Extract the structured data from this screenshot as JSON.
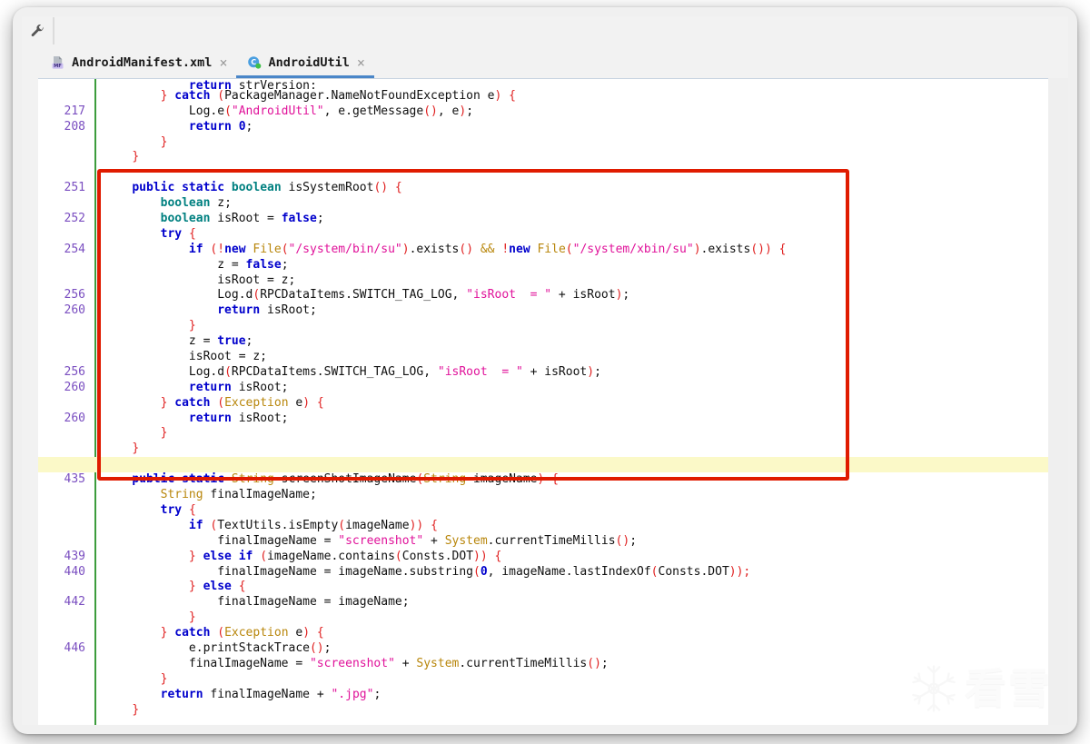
{
  "window": {
    "toolbar": {
      "wrench_icon": "wrench-icon"
    }
  },
  "tabs": [
    {
      "label": "AndroidManifest.xml",
      "icon": "manifest-file-icon",
      "close": "×",
      "active": false
    },
    {
      "label": "AndroidUtil",
      "icon": "java-class-icon",
      "close": "×",
      "active": true
    }
  ],
  "editor": {
    "language": "java",
    "annotation": {
      "type": "red-rectangle",
      "color": "#e01b00",
      "highlight_line_color": "#fbf9c8"
    },
    "lines": [
      {
        "num": "",
        "indent": 0,
        "clipped": true,
        "tokens": [
          {
            "t": "            ",
            "c": "pln"
          },
          {
            "t": "return",
            "c": "kw"
          },
          {
            "t": " strVersion;",
            "c": "pln"
          }
        ]
      },
      {
        "num": "",
        "tokens": [
          {
            "t": "        ",
            "c": "pln"
          },
          {
            "t": "}",
            "c": "brc"
          },
          {
            "t": " ",
            "c": "pln"
          },
          {
            "t": "catch",
            "c": "kw"
          },
          {
            "t": " ",
            "c": "pln"
          },
          {
            "t": "(",
            "c": "pun"
          },
          {
            "t": "PackageManager.NameNotFoundException e",
            "c": "pln"
          },
          {
            "t": ")",
            "c": "pun"
          },
          {
            "t": " ",
            "c": "pln"
          },
          {
            "t": "{",
            "c": "brc"
          }
        ]
      },
      {
        "num": "217",
        "tokens": [
          {
            "t": "            Log.e",
            "c": "pln"
          },
          {
            "t": "(",
            "c": "pun"
          },
          {
            "t": "\"AndroidUtil\"",
            "c": "str"
          },
          {
            "t": ", e.getMessage",
            "c": "pln"
          },
          {
            "t": "()",
            "c": "pun"
          },
          {
            "t": ", e",
            "c": "pln"
          },
          {
            "t": ")",
            "c": "pun"
          },
          {
            "t": ";",
            "c": "pln"
          }
        ]
      },
      {
        "num": "208",
        "tokens": [
          {
            "t": "            ",
            "c": "pln"
          },
          {
            "t": "return",
            "c": "kw"
          },
          {
            "t": " ",
            "c": "pln"
          },
          {
            "t": "0",
            "c": "kw"
          },
          {
            "t": ";",
            "c": "pln"
          }
        ]
      },
      {
        "num": "",
        "tokens": [
          {
            "t": "        ",
            "c": "pln"
          },
          {
            "t": "}",
            "c": "brc"
          }
        ]
      },
      {
        "num": "",
        "tokens": [
          {
            "t": "    ",
            "c": "pln"
          },
          {
            "t": "}",
            "c": "brc"
          }
        ]
      },
      {
        "num": "",
        "tokens": [
          {
            "t": "",
            "c": "pln"
          }
        ]
      },
      {
        "num": "251",
        "tokens": [
          {
            "t": "    ",
            "c": "pln"
          },
          {
            "t": "public static ",
            "c": "kw"
          },
          {
            "t": "boolean",
            "c": "kw2"
          },
          {
            "t": " isSystemRoot",
            "c": "pln"
          },
          {
            "t": "()",
            "c": "pun"
          },
          {
            "t": " ",
            "c": "pln"
          },
          {
            "t": "{",
            "c": "brc"
          }
        ]
      },
      {
        "num": "",
        "tokens": [
          {
            "t": "        ",
            "c": "pln"
          },
          {
            "t": "boolean",
            "c": "kw2"
          },
          {
            "t": " z;",
            "c": "pln"
          }
        ]
      },
      {
        "num": "252",
        "tokens": [
          {
            "t": "        ",
            "c": "pln"
          },
          {
            "t": "boolean",
            "c": "kw2"
          },
          {
            "t": " isRoot = ",
            "c": "pln"
          },
          {
            "t": "false",
            "c": "kw"
          },
          {
            "t": ";",
            "c": "pln"
          }
        ]
      },
      {
        "num": "",
        "tokens": [
          {
            "t": "        ",
            "c": "pln"
          },
          {
            "t": "try",
            "c": "kw"
          },
          {
            "t": " ",
            "c": "pln"
          },
          {
            "t": "{",
            "c": "brc"
          }
        ]
      },
      {
        "num": "254",
        "tokens": [
          {
            "t": "            ",
            "c": "pln"
          },
          {
            "t": "if",
            "c": "kw"
          },
          {
            "t": " ",
            "c": "pln"
          },
          {
            "t": "(",
            "c": "pun"
          },
          {
            "t": "!",
            "c": "pun"
          },
          {
            "t": "new",
            "c": "kw"
          },
          {
            "t": " ",
            "c": "pln"
          },
          {
            "t": "File",
            "c": "typ"
          },
          {
            "t": "(",
            "c": "pun"
          },
          {
            "t": "\"/system/bin/su\"",
            "c": "str"
          },
          {
            "t": ")",
            "c": "pun"
          },
          {
            "t": ".exists",
            "c": "pln"
          },
          {
            "t": "()",
            "c": "pun"
          },
          {
            "t": " ",
            "c": "pln"
          },
          {
            "t": "&&",
            "c": "typ"
          },
          {
            "t": " ",
            "c": "pln"
          },
          {
            "t": "!",
            "c": "pun"
          },
          {
            "t": "new",
            "c": "kw"
          },
          {
            "t": " ",
            "c": "pln"
          },
          {
            "t": "File",
            "c": "typ"
          },
          {
            "t": "(",
            "c": "pun"
          },
          {
            "t": "\"/system/xbin/su\"",
            "c": "str"
          },
          {
            "t": ")",
            "c": "pun"
          },
          {
            "t": ".exists",
            "c": "pln"
          },
          {
            "t": "())",
            "c": "pun"
          },
          {
            "t": " ",
            "c": "pln"
          },
          {
            "t": "{",
            "c": "brc"
          }
        ]
      },
      {
        "num": "",
        "tokens": [
          {
            "t": "                z = ",
            "c": "pln"
          },
          {
            "t": "false",
            "c": "kw"
          },
          {
            "t": ";",
            "c": "pln"
          }
        ]
      },
      {
        "num": "",
        "tokens": [
          {
            "t": "                isRoot = z;",
            "c": "pln"
          }
        ]
      },
      {
        "num": "256",
        "tokens": [
          {
            "t": "                Log.d",
            "c": "pln"
          },
          {
            "t": "(",
            "c": "pun"
          },
          {
            "t": "RPCDataItems.SWITCH_TAG_LOG, ",
            "c": "pln"
          },
          {
            "t": "\"isRoot  = \"",
            "c": "str"
          },
          {
            "t": " + isRoot",
            "c": "pln"
          },
          {
            "t": ")",
            "c": "pun"
          },
          {
            "t": ";",
            "c": "pln"
          }
        ]
      },
      {
        "num": "260",
        "tokens": [
          {
            "t": "                ",
            "c": "pln"
          },
          {
            "t": "return",
            "c": "kw"
          },
          {
            "t": " isRoot;",
            "c": "pln"
          }
        ]
      },
      {
        "num": "",
        "tokens": [
          {
            "t": "            ",
            "c": "pln"
          },
          {
            "t": "}",
            "c": "brc"
          }
        ]
      },
      {
        "num": "",
        "tokens": [
          {
            "t": "            z = ",
            "c": "pln"
          },
          {
            "t": "true",
            "c": "kw"
          },
          {
            "t": ";",
            "c": "pln"
          }
        ]
      },
      {
        "num": "",
        "tokens": [
          {
            "t": "            isRoot = z;",
            "c": "pln"
          }
        ]
      },
      {
        "num": "256",
        "tokens": [
          {
            "t": "            Log.d",
            "c": "pln"
          },
          {
            "t": "(",
            "c": "pun"
          },
          {
            "t": "RPCDataItems.SWITCH_TAG_LOG, ",
            "c": "pln"
          },
          {
            "t": "\"isRoot  = \"",
            "c": "str"
          },
          {
            "t": " + isRoot",
            "c": "pln"
          },
          {
            "t": ")",
            "c": "pun"
          },
          {
            "t": ";",
            "c": "pln"
          }
        ]
      },
      {
        "num": "260",
        "tokens": [
          {
            "t": "            ",
            "c": "pln"
          },
          {
            "t": "return",
            "c": "kw"
          },
          {
            "t": " isRoot;",
            "c": "pln"
          }
        ]
      },
      {
        "num": "",
        "tokens": [
          {
            "t": "        ",
            "c": "pln"
          },
          {
            "t": "}",
            "c": "brc"
          },
          {
            "t": " ",
            "c": "pln"
          },
          {
            "t": "catch",
            "c": "kw"
          },
          {
            "t": " ",
            "c": "pln"
          },
          {
            "t": "(",
            "c": "pun"
          },
          {
            "t": "Exception",
            "c": "typ"
          },
          {
            "t": " e",
            "c": "pln"
          },
          {
            "t": ")",
            "c": "pun"
          },
          {
            "t": " ",
            "c": "pln"
          },
          {
            "t": "{",
            "c": "brc"
          }
        ]
      },
      {
        "num": "260",
        "tokens": [
          {
            "t": "            ",
            "c": "pln"
          },
          {
            "t": "return",
            "c": "kw"
          },
          {
            "t": " isRoot;",
            "c": "pln"
          }
        ]
      },
      {
        "num": "",
        "tokens": [
          {
            "t": "        ",
            "c": "pln"
          },
          {
            "t": "}",
            "c": "brc"
          }
        ]
      },
      {
        "num": "",
        "tokens": [
          {
            "t": "    ",
            "c": "pln"
          },
          {
            "t": "}",
            "c": "brc"
          }
        ]
      },
      {
        "num": "",
        "highlight": true,
        "tokens": [
          {
            "t": "",
            "c": "pln"
          }
        ]
      },
      {
        "num": "435",
        "tokens": [
          {
            "t": "    ",
            "c": "pln"
          },
          {
            "t": "public static ",
            "c": "kw"
          },
          {
            "t": "String",
            "c": "typ"
          },
          {
            "t": " screenShotImageName",
            "c": "pln"
          },
          {
            "t": "(",
            "c": "pun"
          },
          {
            "t": "String",
            "c": "typ"
          },
          {
            "t": " imageName",
            "c": "pln"
          },
          {
            "t": ")",
            "c": "pun"
          },
          {
            "t": " ",
            "c": "pln"
          },
          {
            "t": "{",
            "c": "brc"
          }
        ]
      },
      {
        "num": "",
        "tokens": [
          {
            "t": "        ",
            "c": "pln"
          },
          {
            "t": "String",
            "c": "typ"
          },
          {
            "t": " finalImageName;",
            "c": "pln"
          }
        ]
      },
      {
        "num": "",
        "tokens": [
          {
            "t": "        ",
            "c": "pln"
          },
          {
            "t": "try",
            "c": "kw"
          },
          {
            "t": " ",
            "c": "pln"
          },
          {
            "t": "{",
            "c": "brc"
          }
        ]
      },
      {
        "num": "",
        "tokens": [
          {
            "t": "            ",
            "c": "pln"
          },
          {
            "t": "if",
            "c": "kw"
          },
          {
            "t": " ",
            "c": "pln"
          },
          {
            "t": "(",
            "c": "pun"
          },
          {
            "t": "TextUtils.isEmpty",
            "c": "pln"
          },
          {
            "t": "(",
            "c": "pun"
          },
          {
            "t": "imageName",
            "c": "pln"
          },
          {
            "t": "))",
            "c": "pun"
          },
          {
            "t": " ",
            "c": "pln"
          },
          {
            "t": "{",
            "c": "brc"
          }
        ]
      },
      {
        "num": "",
        "tokens": [
          {
            "t": "                finalImageName = ",
            "c": "pln"
          },
          {
            "t": "\"screenshot\"",
            "c": "str"
          },
          {
            "t": " + ",
            "c": "pln"
          },
          {
            "t": "System",
            "c": "typ"
          },
          {
            "t": ".currentTimeMillis",
            "c": "pln"
          },
          {
            "t": "()",
            "c": "pun"
          },
          {
            "t": ";",
            "c": "pln"
          }
        ]
      },
      {
        "num": "439",
        "tokens": [
          {
            "t": "            ",
            "c": "pln"
          },
          {
            "t": "}",
            "c": "brc"
          },
          {
            "t": " ",
            "c": "pln"
          },
          {
            "t": "else if",
            "c": "kw"
          },
          {
            "t": " ",
            "c": "pln"
          },
          {
            "t": "(",
            "c": "pun"
          },
          {
            "t": "imageName.contains",
            "c": "pln"
          },
          {
            "t": "(",
            "c": "pun"
          },
          {
            "t": "Consts.DOT",
            "c": "pln"
          },
          {
            "t": "))",
            "c": "pun"
          },
          {
            "t": " ",
            "c": "pln"
          },
          {
            "t": "{",
            "c": "brc"
          }
        ]
      },
      {
        "num": "440",
        "tokens": [
          {
            "t": "                finalImageName = imageName.substring",
            "c": "pln"
          },
          {
            "t": "(",
            "c": "pun"
          },
          {
            "t": "0",
            "c": "kw"
          },
          {
            "t": ", imageName.lastIndexOf",
            "c": "pln"
          },
          {
            "t": "(",
            "c": "pun"
          },
          {
            "t": "Consts.DOT",
            "c": "pln"
          },
          {
            "t": "));",
            "c": "pun"
          }
        ]
      },
      {
        "num": "",
        "tokens": [
          {
            "t": "            ",
            "c": "pln"
          },
          {
            "t": "}",
            "c": "brc"
          },
          {
            "t": " ",
            "c": "pln"
          },
          {
            "t": "else",
            "c": "kw"
          },
          {
            "t": " ",
            "c": "pln"
          },
          {
            "t": "{",
            "c": "brc"
          }
        ]
      },
      {
        "num": "442",
        "tokens": [
          {
            "t": "                finalImageName = imageName;",
            "c": "pln"
          }
        ]
      },
      {
        "num": "",
        "tokens": [
          {
            "t": "            ",
            "c": "pln"
          },
          {
            "t": "}",
            "c": "brc"
          }
        ]
      },
      {
        "num": "",
        "tokens": [
          {
            "t": "        ",
            "c": "pln"
          },
          {
            "t": "}",
            "c": "brc"
          },
          {
            "t": " ",
            "c": "pln"
          },
          {
            "t": "catch",
            "c": "kw"
          },
          {
            "t": " ",
            "c": "pln"
          },
          {
            "t": "(",
            "c": "pun"
          },
          {
            "t": "Exception",
            "c": "typ"
          },
          {
            "t": " e",
            "c": "pln"
          },
          {
            "t": ")",
            "c": "pun"
          },
          {
            "t": " ",
            "c": "pln"
          },
          {
            "t": "{",
            "c": "brc"
          }
        ]
      },
      {
        "num": "446",
        "tokens": [
          {
            "t": "            e.printStackTrace",
            "c": "pln"
          },
          {
            "t": "()",
            "c": "pun"
          },
          {
            "t": ";",
            "c": "pln"
          }
        ]
      },
      {
        "num": "",
        "tokens": [
          {
            "t": "            finalImageName = ",
            "c": "pln"
          },
          {
            "t": "\"screenshot\"",
            "c": "str"
          },
          {
            "t": " + ",
            "c": "pln"
          },
          {
            "t": "System",
            "c": "typ"
          },
          {
            "t": ".currentTimeMillis",
            "c": "pln"
          },
          {
            "t": "()",
            "c": "pun"
          },
          {
            "t": ";",
            "c": "pln"
          }
        ]
      },
      {
        "num": "",
        "tokens": [
          {
            "t": "        ",
            "c": "pln"
          },
          {
            "t": "}",
            "c": "brc"
          }
        ]
      },
      {
        "num": "",
        "tokens": [
          {
            "t": "        ",
            "c": "pln"
          },
          {
            "t": "return",
            "c": "kw"
          },
          {
            "t": " finalImageName + ",
            "c": "pln"
          },
          {
            "t": "\".jpg\"",
            "c": "str"
          },
          {
            "t": ";",
            "c": "pln"
          }
        ]
      },
      {
        "num": "",
        "tokens": [
          {
            "t": "    ",
            "c": "pln"
          },
          {
            "t": "}",
            "c": "brc"
          }
        ]
      }
    ]
  },
  "watermark": {
    "icon": "snowflake-icon",
    "text": "看雪"
  }
}
